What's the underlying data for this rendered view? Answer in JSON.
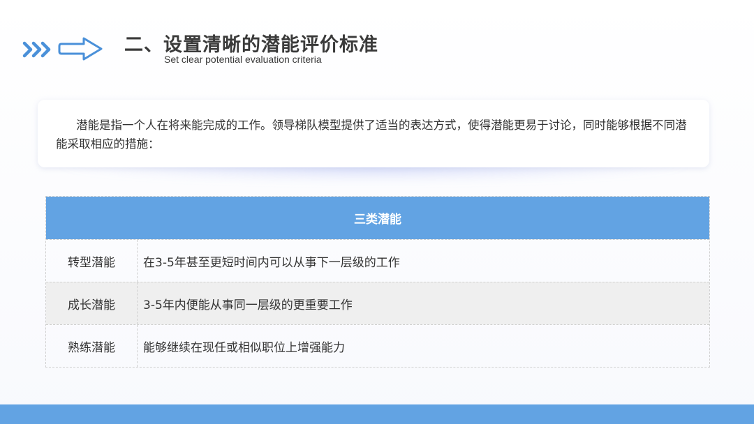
{
  "header": {
    "title": "二、设置清晰的潜能评价标准",
    "subtitle": "Set clear potential evaluation criteria"
  },
  "intro": {
    "text": "潜能是指一个人在将来能完成的工作。领导梯队模型提供了适当的表达方式，使得潜能更易于讨论，同时能够根据不同潜能采取相应的措施："
  },
  "table": {
    "header": "三类潜能",
    "rows": [
      {
        "name": "转型潜能",
        "desc": "在3-5年甚至更短时间内可以从事下一层级的工作"
      },
      {
        "name": "成长潜能",
        "desc": "3-5年内便能从事同一层级的更重要工作"
      },
      {
        "name": "熟练潜能",
        "desc": "能够继续在现任或相似职位上增强能力"
      }
    ]
  },
  "colors": {
    "accent": "#62a3e3",
    "chevron": "#4a90d9",
    "text": "#333333"
  },
  "icons": [
    "double-chevron-right-icon",
    "outline-arrow-right-icon"
  ]
}
